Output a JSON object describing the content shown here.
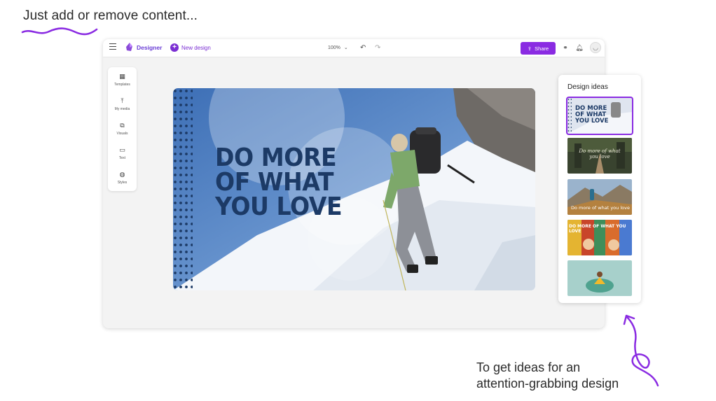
{
  "headline": "Just add or remove content...",
  "bottom_note": "To get ideas for an\nattention-grabbing design",
  "app": {
    "name": "Designer",
    "new_design_label": "New design",
    "zoom": "100%",
    "share_label": "Share"
  },
  "tools": [
    {
      "icon": "templates-icon",
      "label": "Templates"
    },
    {
      "icon": "my-media-icon",
      "label": "My media"
    },
    {
      "icon": "visuals-icon",
      "label": "Visuals"
    },
    {
      "icon": "text-icon",
      "label": "Text"
    },
    {
      "icon": "styles-icon",
      "label": "Styles"
    }
  ],
  "canvas": {
    "title": "DO MORE\nOF WHAT\nYOU LOVE"
  },
  "ideas": {
    "title": "Design ideas",
    "items": [
      {
        "caption": "DO MORE\nOF WHAT\nYOU LOVE",
        "selected": true
      },
      {
        "caption": "Do more of what\nyou love",
        "selected": false
      },
      {
        "caption": "Do more of what you love",
        "selected": false
      },
      {
        "caption": "DO MORE OF WHAT YOU LOVE",
        "selected": false
      },
      {
        "caption": "",
        "selected": false
      }
    ]
  },
  "colors": {
    "accent": "#8a2be2",
    "brand_text": "#6b3fd6",
    "title_navy": "#1c3a66"
  }
}
